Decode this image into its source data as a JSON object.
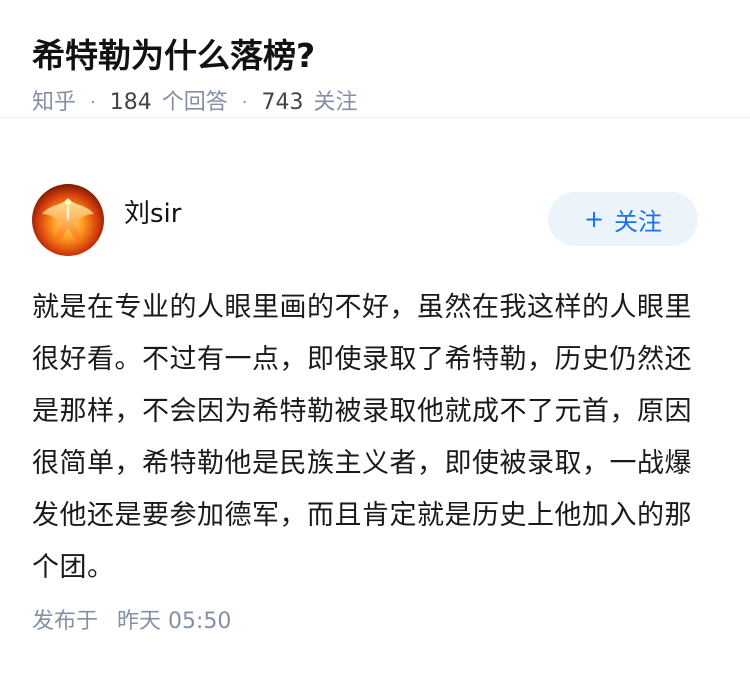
{
  "question": {
    "title": "希特勒为什么落榜?",
    "source": "知乎",
    "separator": "·",
    "answer_count": "184",
    "answer_label": "个回答",
    "follow_count": "743",
    "follow_label": "关注"
  },
  "answer": {
    "author_name": "刘sir",
    "follow_button": {
      "icon": "+",
      "label": "关注"
    },
    "content": "就是在专业的人眼里画的不好，虽然在我这样的人眼里很好看。不过有一点，即使录取了希特勒，历史仍然还是那样，不会因为希特勒被录取他就成不了元首，原因很简单，希特勒他是民族主义者，即使被录取，一战爆发他还是要参加德军，而且肯定就是历史上他加入的那个团。",
    "publish_label": "发布于",
    "publish_time": "昨天 05:50"
  },
  "colors": {
    "accent": "#1772f6",
    "button_bg": "#ebf3fb",
    "meta_text": "#8590a6"
  }
}
